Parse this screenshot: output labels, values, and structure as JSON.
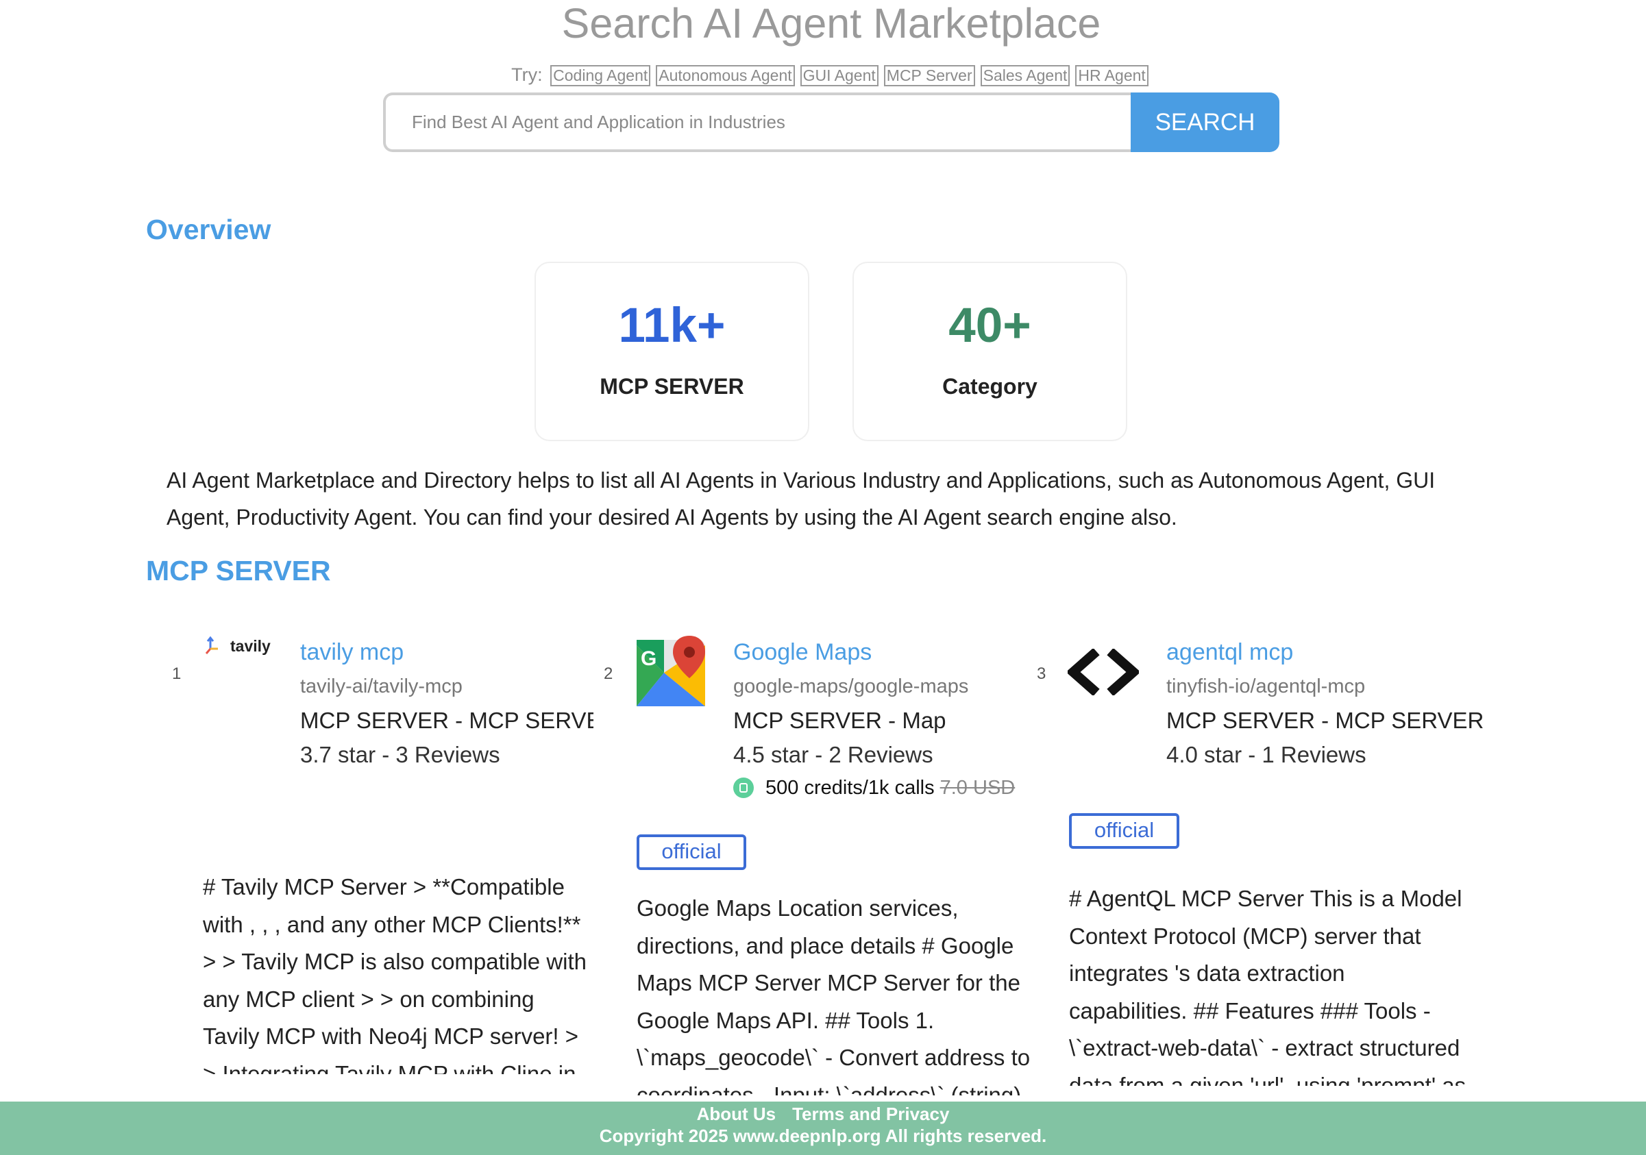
{
  "hero": {
    "title": "Search AI Agent Marketplace",
    "try_label": "Try:",
    "tags": [
      "Coding Agent",
      "Autonomous Agent",
      "GUI Agent",
      "MCP Server",
      "Sales Agent",
      "HR Agent"
    ]
  },
  "search": {
    "placeholder": "Find Best AI Agent and Application in Industries",
    "button_label": "SEARCH"
  },
  "overview": {
    "heading": "Overview",
    "stats": [
      {
        "value": "11k+",
        "label": "MCP SERVER",
        "color": "#2f63d8"
      },
      {
        "value": "40+",
        "label": "Category",
        "color": "#3d8a66"
      }
    ],
    "intro": "AI Agent Marketplace and Directory helps to list all AI Agents in Various Industry and Applications, such as Autonomous Agent, GUI Agent, Productivity Agent. You can find your desired AI Agents by using the AI Agent search engine also."
  },
  "mcp": {
    "heading": "MCP SERVER",
    "cards": [
      {
        "index": "1",
        "logo": "tavily",
        "logo_text": "tavily",
        "title": "tavily mcp",
        "repo": "tavily-ai/tavily-mcp",
        "category": "MCP SERVER - MCP SERVER",
        "rating": "3.7 star - 3 Reviews",
        "description": "# Tavily MCP Server > **Compatible with , , , and any other MCP Clients!** > > Tavily MCP is also compatible with any MCP client > > on combining Tavily MCP with Neo4j MCP server! > > Integrating Tavily MCP with Cline in VS Code ( Demo"
      },
      {
        "index": "2",
        "logo": "google-maps",
        "title": "Google Maps",
        "repo": "google-maps/google-maps",
        "category": "MCP SERVER - Map",
        "rating": "4.5 star - 2 Reviews",
        "price": "500 credits/1k calls",
        "price_old": "7.0 USD",
        "badge": "official",
        "description": "Google Maps Location services, directions, and place details # Google Maps MCP Server MCP Server for the Google Maps API. ## Tools 1. \\`maps_geocode\\` - Convert address to coordinates - Input: \\`address\\` (string)"
      },
      {
        "index": "3",
        "logo": "code-brackets",
        "title": "agentql mcp",
        "repo": "tinyfish-io/agentql-mcp",
        "category": "MCP SERVER - MCP SERVER",
        "rating": "4.0 star - 1 Reviews",
        "badge": "official",
        "description": "# AgentQL MCP Server This is a Model Context Protocol (MCP) server that integrates 's data extraction capabilities. ## Features ### Tools - \\`extract-web-data\\` - extract structured data from a given 'url', using 'prompt' as a description"
      }
    ]
  },
  "footer": {
    "links": [
      "About Us",
      "Terms and Privacy"
    ],
    "copyright": "Copyright 2025 www.deepnlp.org All rights reserved."
  }
}
